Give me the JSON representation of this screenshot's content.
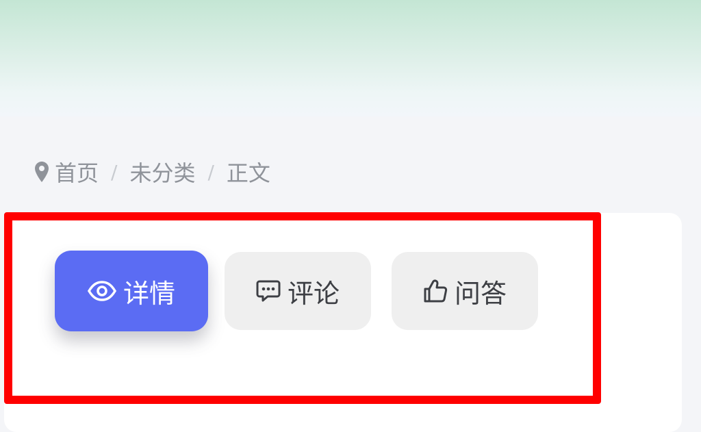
{
  "breadcrumb": {
    "items": [
      "首页",
      "未分类",
      "正文"
    ],
    "separator": "/"
  },
  "tabs": [
    {
      "label": "详情",
      "icon": "eye-icon",
      "active": true
    },
    {
      "label": "评论",
      "icon": "comment-icon",
      "active": false
    },
    {
      "label": "问答",
      "icon": "thumbs-up-icon",
      "active": false
    }
  ],
  "colors": {
    "active_tab": "#5b6cf3",
    "inactive_tab": "#efefef",
    "highlight": "#ff0000"
  }
}
